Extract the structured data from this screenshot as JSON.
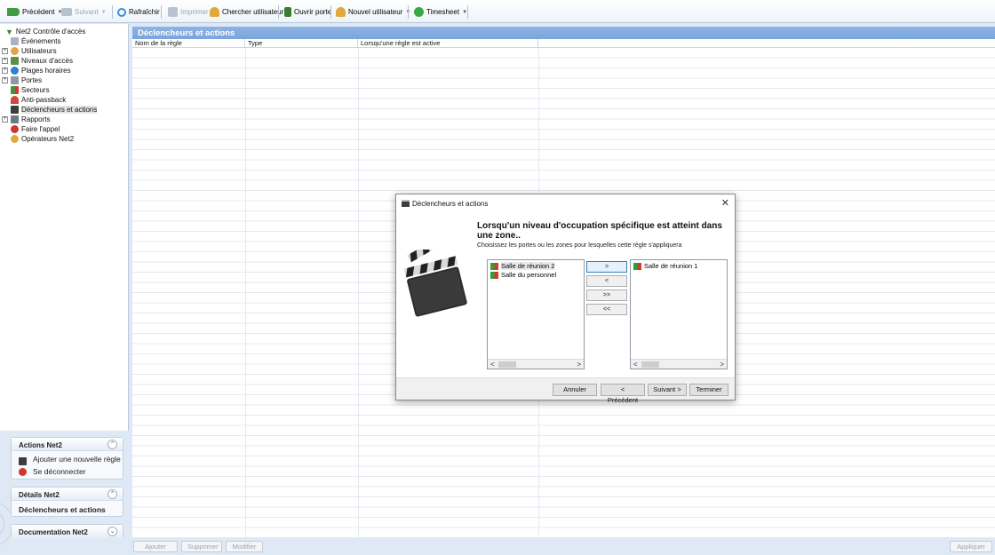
{
  "toolbar": {
    "back": "Précédent",
    "forward": "Suivant",
    "refresh": "Rafraîchir",
    "print": "Imprimer",
    "search_user": "Chercher utilisateur",
    "open_door": "Ouvrir porte",
    "new_user": "Nouvel utilisateur",
    "timesheet": "Timesheet"
  },
  "tree": {
    "root": "Net2 Contrôle d'accès",
    "items": [
      {
        "label": "Événements",
        "expandable": false
      },
      {
        "label": "Utilisateurs",
        "expandable": true
      },
      {
        "label": "Niveaux d'accès",
        "expandable": true
      },
      {
        "label": "Plages horaires",
        "expandable": true
      },
      {
        "label": "Portes",
        "expandable": true
      },
      {
        "label": "Secteurs",
        "expandable": false
      },
      {
        "label": "Anti-passback",
        "expandable": false
      },
      {
        "label": "Déclencheurs et actions",
        "expandable": false
      },
      {
        "label": "Rapports",
        "expandable": true
      },
      {
        "label": "Faire l'appel",
        "expandable": false
      },
      {
        "label": "Opérateurs Net2",
        "expandable": false
      }
    ]
  },
  "actions_panel": {
    "title": "Actions Net2",
    "add_rule": "Ajouter une nouvelle règle",
    "disconnect": "Se déconnecter"
  },
  "details_panel": {
    "title": "Détails Net2",
    "value": "Déclencheurs et actions"
  },
  "docs_panel": {
    "title": "Documentation Net2"
  },
  "main": {
    "title": "Déclencheurs et actions",
    "columns": [
      "Nom de la règle",
      "Type",
      "Lorsqu'une règle est active"
    ]
  },
  "bottom_buttons": {
    "add": "Ajouter",
    "delete": "Supprimer",
    "modify": "Modifier",
    "apply": "Appliquer"
  },
  "dialog": {
    "title": "Déclencheurs et actions",
    "heading": "Lorsqu'un niveau d'occupation spécifique est atteint dans une zone..",
    "subtitle": "Choisissez les portes ou les zones pour lesquelles cette règle s'appliquera",
    "available": [
      "Salle de réunion 2",
      "Salle du personnel"
    ],
    "selected": [
      "Salle de réunion 1"
    ],
    "move_buttons": [
      ">",
      "<",
      ">>",
      "<<"
    ],
    "footer": {
      "cancel": "Annuler",
      "previous": "< Précédent",
      "next": "Suivant >",
      "finish": "Terminer"
    }
  },
  "icons": {
    "back": "back-arrow-icon",
    "forward": "forward-arrow-icon",
    "refresh": "refresh-icon",
    "print": "printer-icon",
    "search_user": "user-search-icon",
    "open_door": "door-icon",
    "new_user": "add-user-icon",
    "timesheet": "clock-icon"
  },
  "colors": {
    "header_blue": "#7aa6dc",
    "accent_green": "#2f9e3a",
    "primary_border": "#3c7fb1"
  }
}
